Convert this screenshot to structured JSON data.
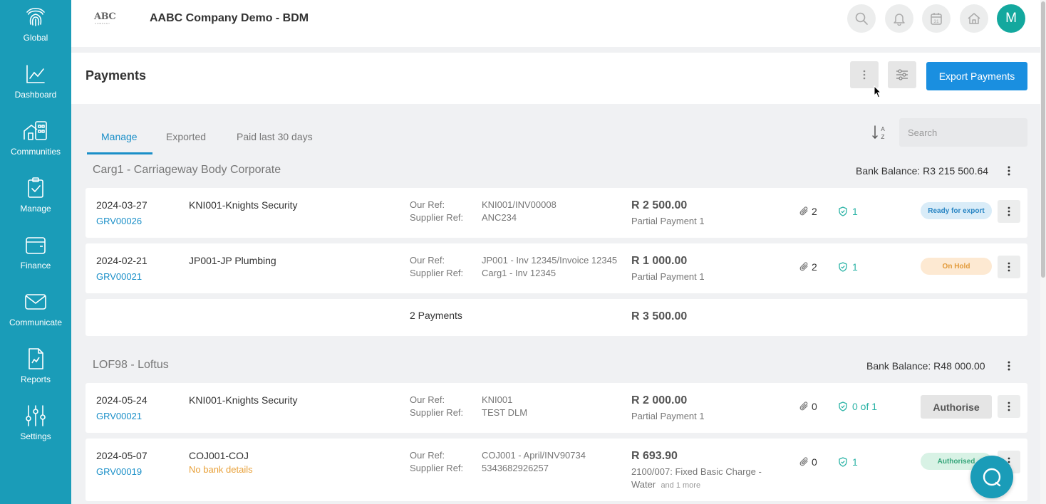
{
  "app": {
    "company_title": "AABC Company Demo - BDM",
    "logo_text": "ABC",
    "avatar_initial": "M"
  },
  "sidebar": {
    "items": [
      {
        "label": "Global",
        "icon": "fingerprint-icon"
      },
      {
        "label": "Dashboard",
        "icon": "line-chart-icon"
      },
      {
        "label": "Communities",
        "icon": "buildings-icon"
      },
      {
        "label": "Manage",
        "icon": "clipboard-check-icon"
      },
      {
        "label": "Finance",
        "icon": "wallet-icon"
      },
      {
        "label": "Communicate",
        "icon": "envelope-icon"
      },
      {
        "label": "Reports",
        "icon": "report-icon"
      },
      {
        "label": "Settings",
        "icon": "sliders-icon"
      }
    ]
  },
  "topbar": {
    "icons": [
      "search-icon",
      "bell-icon",
      "calendar-icon",
      "home-icon"
    ],
    "calendar_day": "31"
  },
  "page": {
    "title": "Payments",
    "export_label": "Export Payments"
  },
  "tabs": [
    {
      "label": "Manage",
      "active": true
    },
    {
      "label": "Exported",
      "active": false
    },
    {
      "label": "Paid last 30 days",
      "active": false
    }
  ],
  "search": {
    "placeholder": "Search",
    "value": ""
  },
  "groups": [
    {
      "title": "Carg1 - Carriageway Body Corporate",
      "bank_balance": "Bank Balance: R3 215 500.64",
      "payments": [
        {
          "date": "2024-03-27",
          "grv": "GRV00026",
          "supplier": "KNI001-Knights Security",
          "warning": "",
          "our_ref_label": "Our Ref:",
          "our_ref": "KNI001/INV00008",
          "supplier_ref_label": "Supplier Ref:",
          "supplier_ref": "ANC234",
          "amount": "R 2 500.00",
          "description": "Partial Payment 1",
          "more": "",
          "attachments": "2",
          "approvals": "1",
          "status": "Ready for export",
          "status_type": "ready"
        },
        {
          "date": "2024-02-21",
          "grv": "GRV00021",
          "supplier": "JP001-JP Plumbing",
          "warning": "",
          "our_ref_label": "Our Ref:",
          "our_ref": "JP001 - Inv 12345/Invoice 12345",
          "supplier_ref_label": "Supplier Ref:",
          "supplier_ref": "Carg1 - Inv 12345",
          "amount": "R 1 000.00",
          "description": "Partial Payment 1",
          "more": "",
          "attachments": "2",
          "approvals": "1",
          "status": "On Hold",
          "status_type": "hold"
        }
      ],
      "total_count": "2 Payments",
      "total_amount": "R 3 500.00"
    },
    {
      "title": "LOF98 - Loftus",
      "bank_balance": "Bank Balance: R48 000.00",
      "payments": [
        {
          "date": "2024-05-24",
          "grv": "GRV00021",
          "supplier": "KNI001-Knights Security",
          "warning": "",
          "our_ref_label": "Our Ref:",
          "our_ref": "KNI001",
          "supplier_ref_label": "Supplier Ref:",
          "supplier_ref": "TEST DLM",
          "amount": "R 2 000.00",
          "description": "Partial Payment 1",
          "more": "",
          "attachments": "0",
          "approvals": "0 of 1",
          "status": "Authorise",
          "status_type": "authorise"
        },
        {
          "date": "2024-05-07",
          "grv": "GRV00019",
          "supplier": "COJ001-COJ",
          "warning": "No bank details",
          "our_ref_label": "Our Ref:",
          "our_ref": "COJ001 - April/INV90734",
          "supplier_ref_label": "Supplier Ref:",
          "supplier_ref": "5343682926257",
          "amount": "R 693.90",
          "description": "2100/007: Fixed Basic Charge -",
          "description_2": "Water",
          "more": "and 1 more",
          "attachments": "0",
          "approvals": "1",
          "status": "Authorised",
          "status_type": "authorised"
        }
      ]
    }
  ],
  "colors": {
    "sidebar": "#1a9cb8",
    "primary_button": "#1a8fe0",
    "link": "#1a8fc8",
    "avatar": "#13a89e",
    "warning": "#e8a13a"
  }
}
